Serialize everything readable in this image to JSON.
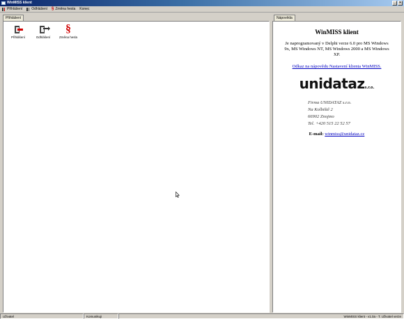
{
  "window": {
    "title": "WinMISS klient",
    "controls": [
      "_",
      "×"
    ]
  },
  "menu": {
    "items": [
      {
        "label": "Přihlášení",
        "icon": "login-icon"
      },
      {
        "label": "Odhlášení",
        "icon": "logout-icon"
      },
      {
        "label": "Změna hesla",
        "icon": "paragraph-icon"
      },
      {
        "label": "Konec",
        "icon": ""
      }
    ]
  },
  "left_tab": "Přihlášení",
  "toolbar": {
    "login": "Přihlášení",
    "logout": "Odhlášení",
    "change_password": "Změna hesla",
    "para_symbol": "§"
  },
  "right_tab": "Nápověda",
  "help": {
    "title": "WinMISS klient",
    "description": "Je naprogramovaný v Delphi verze 6.0 pro MS Windows 9x, MS Windows NT, MS Windows 2000 a MS Windows XP.",
    "link": "Odkaz na nápovědu Nastavení klienta WinMISS.",
    "logo_main": "unidataz",
    "logo_suffix": "s.r.o.",
    "address": {
      "firm": "Firma UNIDATAZ s.r.o.",
      "street": "Na Kolbiště 2",
      "city": "66902 Znojmo",
      "phone": "Tel. +420 515 22 52 57"
    },
    "email_label": "E-mail:",
    "email": "winmiss@unidataz.cz"
  },
  "status": {
    "left": "Uživatel",
    "middle": "Komunikuji",
    "right": "WinMISS klient - v1.0a - T. Uživatel verze"
  }
}
